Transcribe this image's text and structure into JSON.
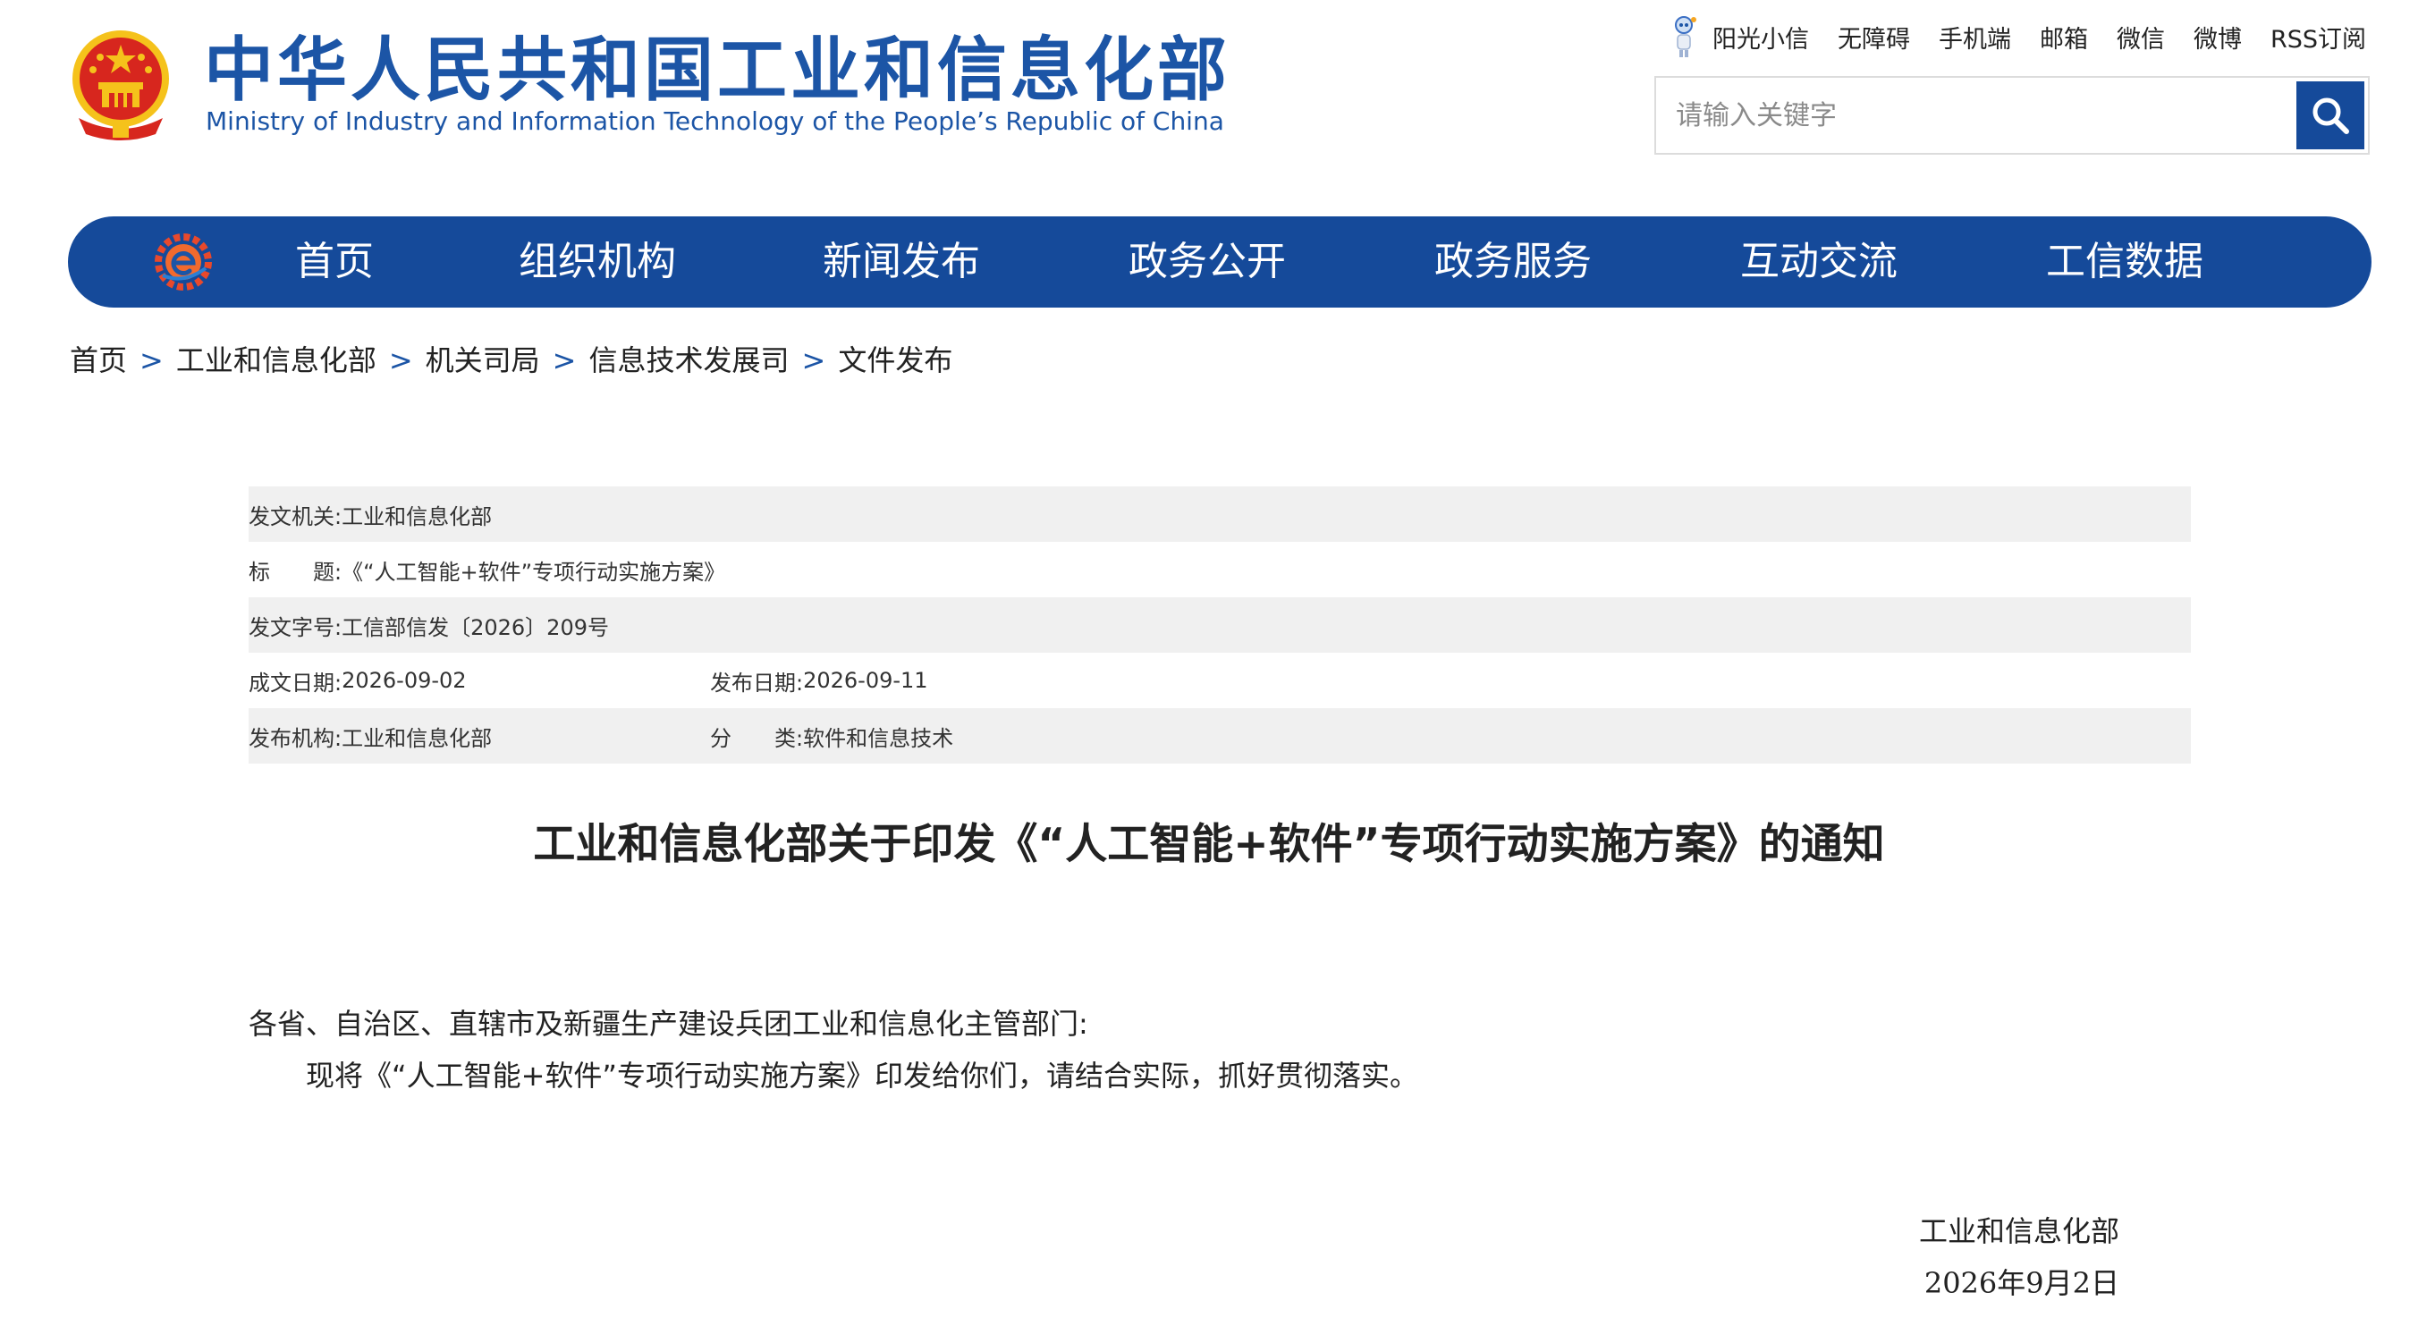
{
  "header": {
    "site_name": "中华人民共和国工业和信息化部",
    "site_name_en": "Ministry of Industry and Information Technology of the People’s Republic of China",
    "top_links": [
      "阳光小信",
      "无障碍",
      "手机端",
      "邮箱",
      "微信",
      "微博",
      "RSS订阅"
    ],
    "search": {
      "placeholder": "请输入关键字",
      "value": ""
    }
  },
  "nav": {
    "items": [
      "首页",
      "组织机构",
      "新闻发布",
      "政务公开",
      "政务服务",
      "互动交流",
      "工信数据"
    ]
  },
  "breadcrumb": [
    "首页",
    "工业和信息化部",
    "机关司局",
    "信息技术发展司",
    "文件发布"
  ],
  "breadcrumb_separator": ">",
  "meta": {
    "issuer_label": "发文机关:",
    "issuer": "工业和信息化部",
    "title_label": "标　　题:",
    "title": "《“人工智能+软件”专项行动实施方案》",
    "doc_number_label": "发文字号:",
    "doc_number": "工信部信发〔2026〕209号",
    "written_date_label": "成文日期:",
    "written_date": "2026-09-02",
    "publish_date_label": "发布日期:",
    "publish_date": "2026-09-11",
    "publisher_label": "发布机构:",
    "publisher": "工业和信息化部",
    "category_label": "分　　类:",
    "category": "软件和信息技术"
  },
  "article": {
    "title": "工业和信息化部关于印发《“人工智能+软件”专项行动实施方案》的通知",
    "salutation": "各省、自治区、直辖市及新疆生产建设兵团工业和信息化主管部门:",
    "body": "现将《“人工智能+软件”专项行动实施方案》印发给你们，请结合实际，抓好贯彻落实。",
    "signature_org": "工业和信息化部",
    "signature_date": "2026年9月2日"
  },
  "colors": {
    "brand_blue": "#154a9a",
    "title_blue": "#1c55a6",
    "emblem_red": "#d7261e",
    "emblem_gold": "#f5c21b",
    "meta_row_shade": "#f0f0f0"
  },
  "icons": {
    "emblem": "national-emblem-icon",
    "robot": "robot-mascot-icon",
    "search": "search-icon",
    "nav_logo": "gear-e-logo-icon"
  }
}
